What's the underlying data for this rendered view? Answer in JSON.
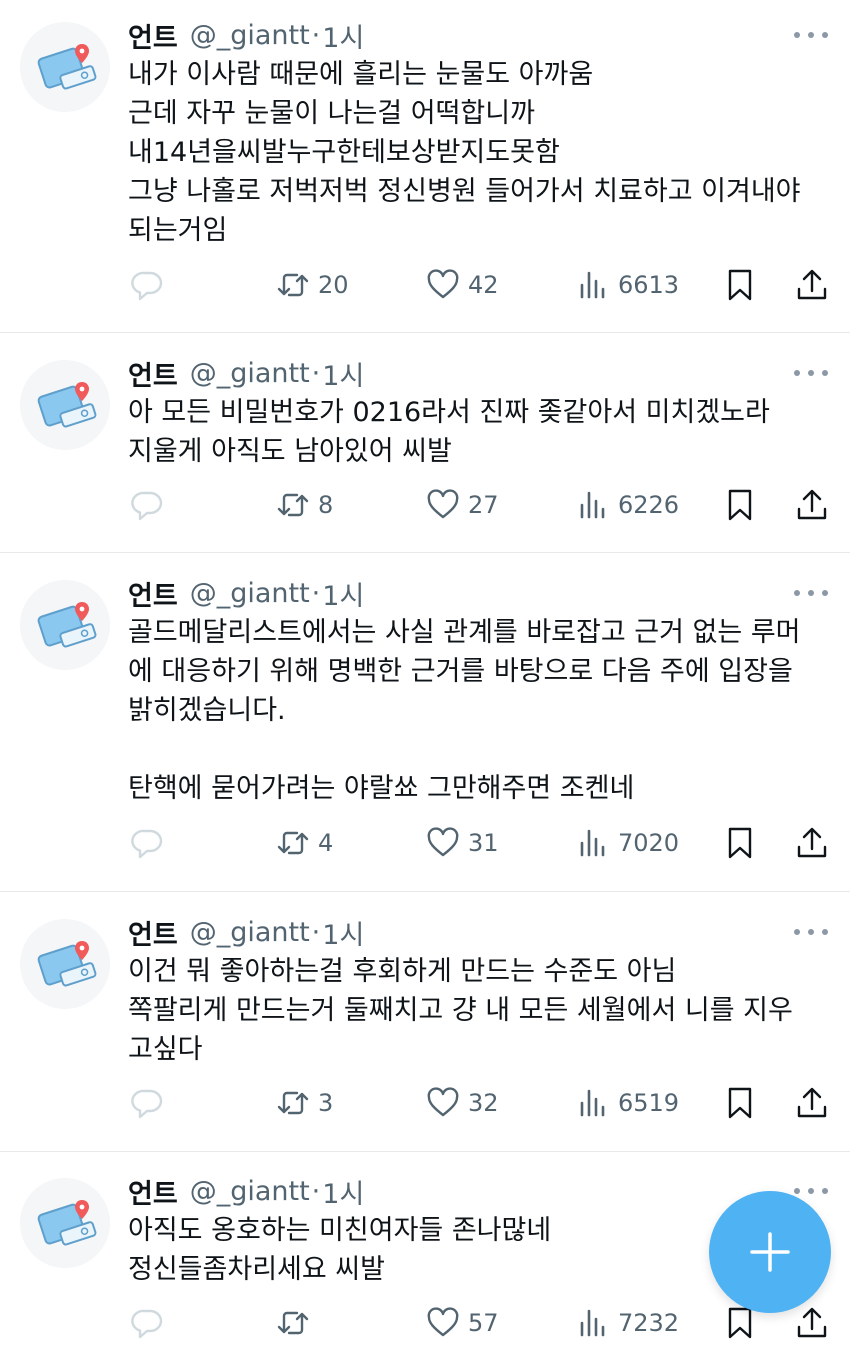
{
  "tweets": [
    {
      "name": "언트",
      "handle": "@_giantt",
      "separator": "·",
      "time": "1시",
      "text": "내가 이사람 때문에 흘리는 눈물도 아까움\n근데 자꾸 눈물이 나는걸 어떡합니까\n내14년을씨발누구한테보상받지도못함\n그냥 나홀로 저벅저벅 정신병원 들어가서 치료하고 이겨내야\n되는거임",
      "retweets": "20",
      "likes": "42",
      "views": "6613"
    },
    {
      "name": "언트",
      "handle": "@_giantt",
      "separator": "·",
      "time": "1시",
      "text": "아 모든 비밀번호가 0216라서 진짜 좆같아서 미치겠노라\n지울게 아직도 남아있어 씨발",
      "retweets": "8",
      "likes": "27",
      "views": "6226"
    },
    {
      "name": "언트",
      "handle": "@_giantt",
      "separator": "·",
      "time": "1시",
      "text": "골드메달리스트에서는 사실 관계를 바로잡고 근거 없는 루머\n에 대응하기 위해 명백한 근거를 바탕으로 다음 주에 입장을\n밝히겠습니다.\n\n탄핵에 묻어가려는 야랄쑈 그만해주면 조켄네",
      "retweets": "4",
      "likes": "31",
      "views": "7020"
    },
    {
      "name": "언트",
      "handle": "@_giantt",
      "separator": "·",
      "time": "1시",
      "text": "이건 뭐 좋아하는걸 후회하게 만드는 수준도 아님\n쪽팔리게 만드는거 둘째치고 걍 내 모든 세월에서 니를 지우\n고싶다",
      "retweets": "3",
      "likes": "32",
      "views": "6519"
    },
    {
      "name": "언트",
      "handle": "@_giantt",
      "separator": "·",
      "time": "1시",
      "text": "아직도 옹호하는 미친여자들 존나많네\n정신들좀차리세요 씨발",
      "retweets": "",
      "likes": "57",
      "views": "7232"
    }
  ],
  "icons": {
    "reply": "reply-icon",
    "retweet": "retweet-icon",
    "like": "heart-icon",
    "views": "views-icon",
    "bookmark": "bookmark-icon",
    "share": "share-icon",
    "more": "more-icon",
    "compose": "plus-icon"
  },
  "colors": {
    "accent": "#4fb2f3",
    "muted": "#536471",
    "text": "#0f1419",
    "divider": "#e7e9ea"
  }
}
